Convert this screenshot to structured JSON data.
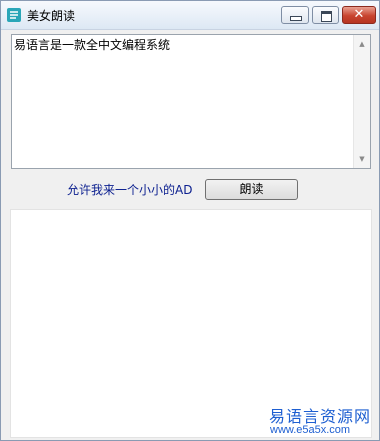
{
  "window": {
    "title": "美女朗读",
    "controls": {
      "minimize": "",
      "maximize": "",
      "close": "✕"
    }
  },
  "editor": {
    "value": "易语言是一款全中文编程系统"
  },
  "ad": {
    "label": "允许我来一个小小的AD"
  },
  "buttons": {
    "read": "朗读"
  },
  "watermark": {
    "title": "易语言资源网",
    "url": "www.e5a5x.com"
  },
  "colors": {
    "ad_text": "#0b1f8f",
    "watermark": "#1e5fd1",
    "close_button": "#c8442f"
  },
  "icons": [
    "app-icon",
    "minimize-icon",
    "maximize-icon",
    "close-icon",
    "scroll-up-icon",
    "scroll-down-icon"
  ]
}
